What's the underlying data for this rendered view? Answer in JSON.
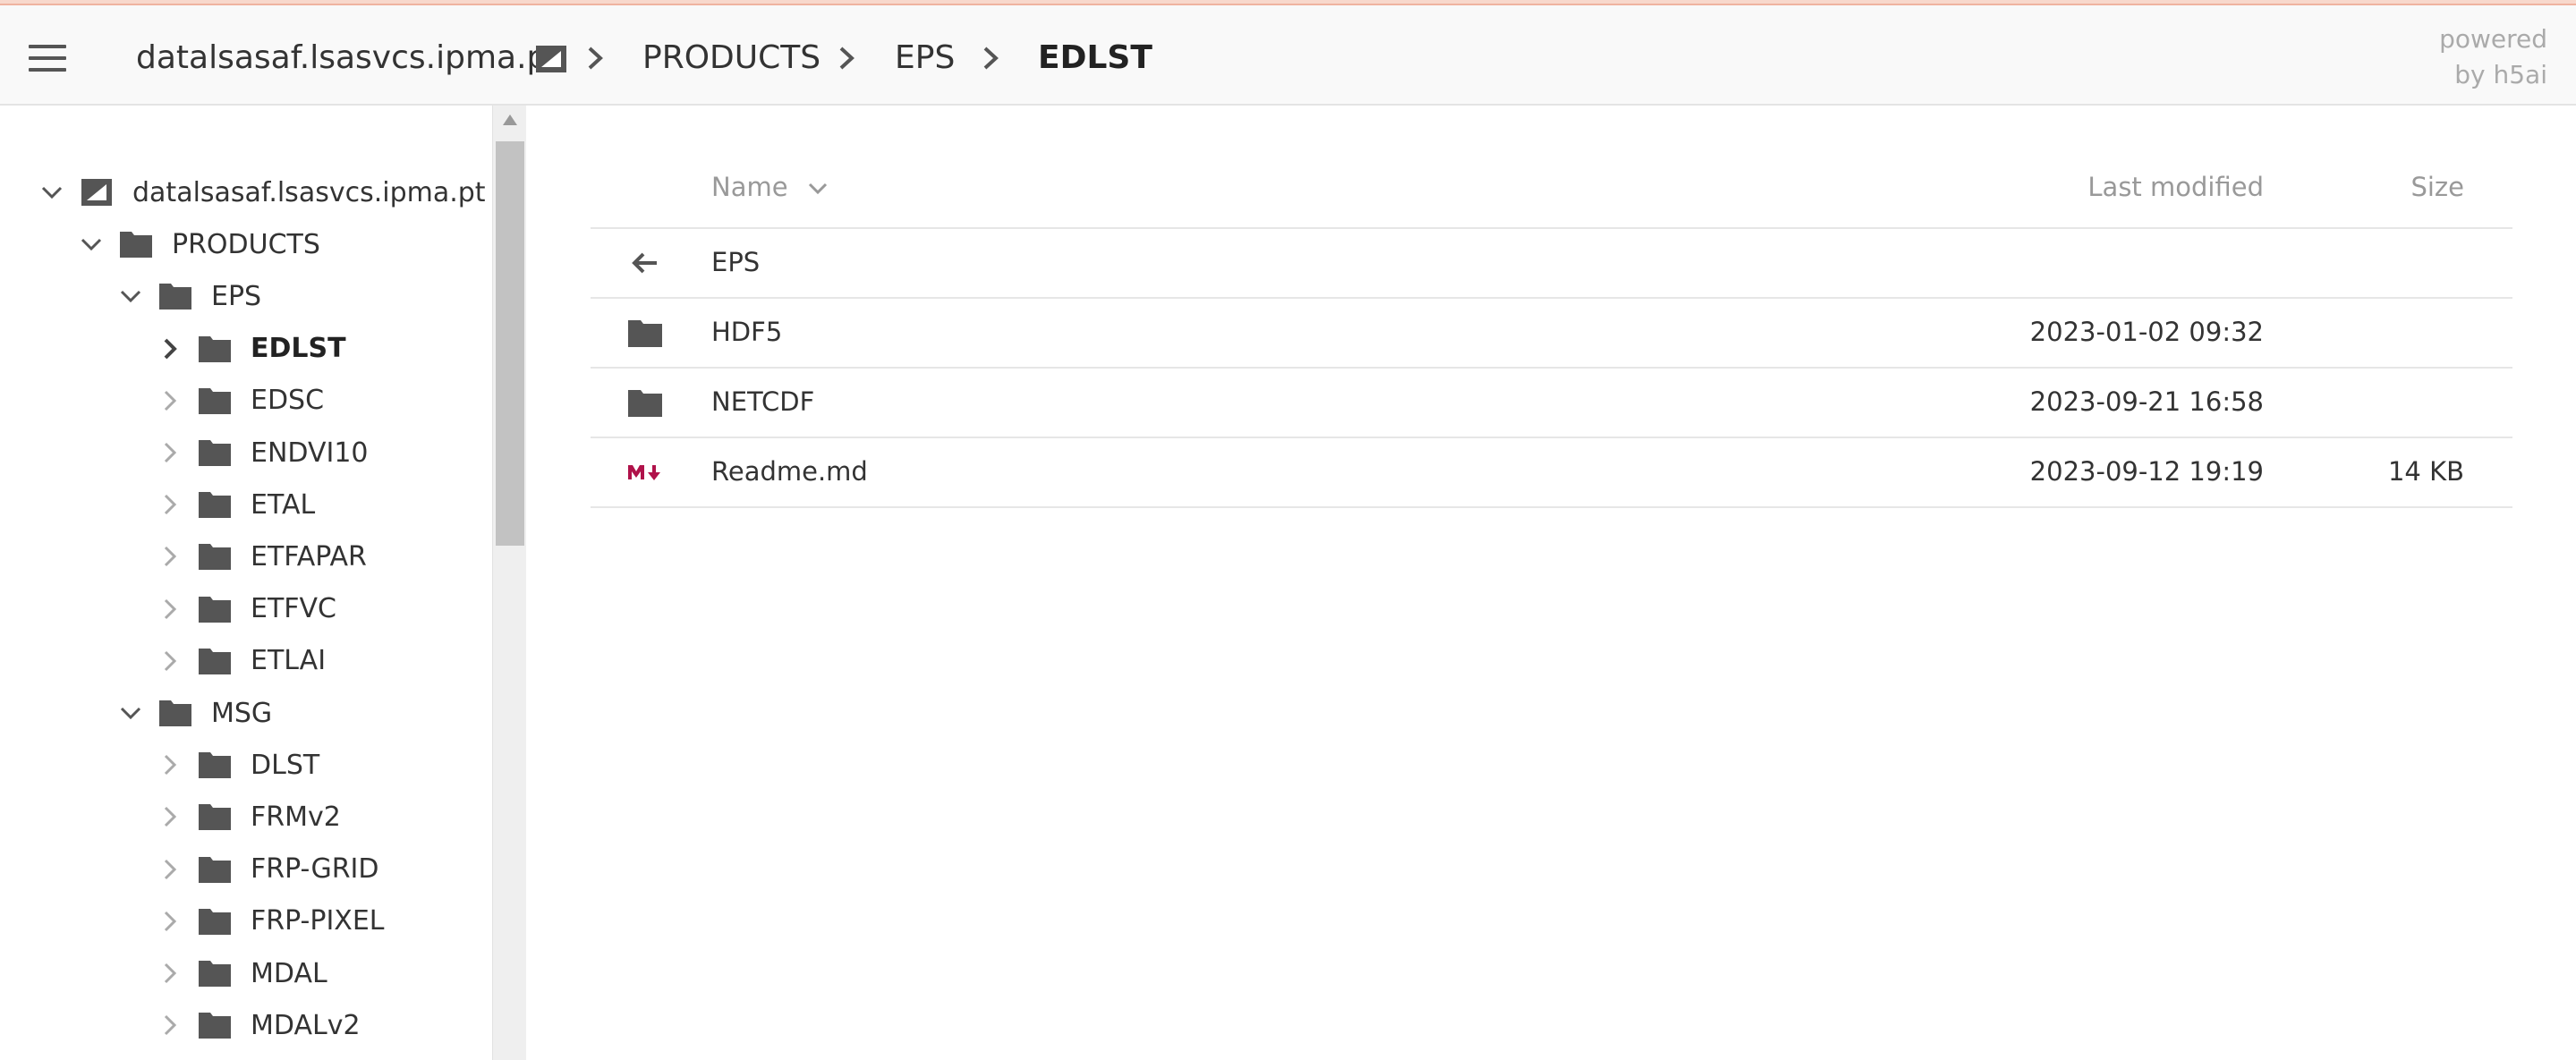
{
  "header": {
    "breadcrumb": [
      {
        "label": "datalsasaf.lsasvcs.ipma.pt"
      },
      {
        "label": "PRODUCTS"
      },
      {
        "label": "EPS"
      },
      {
        "label": "EDLST"
      }
    ],
    "powered_line1": "powered",
    "powered_line2": "by h5ai"
  },
  "sidebar": {
    "tree": [
      {
        "label": "datalsasaf.lsasvcs.ipma.pt",
        "level": 0,
        "expanded": true,
        "icon": "root-folder-icon"
      },
      {
        "label": "PRODUCTS",
        "level": 1,
        "expanded": true,
        "icon": "folder-icon"
      },
      {
        "label": "EPS",
        "level": 2,
        "expanded": true,
        "icon": "folder-icon"
      },
      {
        "label": "EDLST",
        "level": 3,
        "expanded": false,
        "active": true,
        "icon": "folder-icon"
      },
      {
        "label": "EDSC",
        "level": 3,
        "expanded": false,
        "icon": "folder-icon"
      },
      {
        "label": "ENDVI10",
        "level": 3,
        "expanded": false,
        "icon": "folder-icon"
      },
      {
        "label": "ETAL",
        "level": 3,
        "expanded": false,
        "icon": "folder-icon"
      },
      {
        "label": "ETFAPAR",
        "level": 3,
        "expanded": false,
        "icon": "folder-icon"
      },
      {
        "label": "ETFVC",
        "level": 3,
        "expanded": false,
        "icon": "folder-icon"
      },
      {
        "label": "ETLAI",
        "level": 3,
        "expanded": false,
        "icon": "folder-icon"
      },
      {
        "label": "MSG",
        "level": 2,
        "expanded": true,
        "icon": "folder-icon"
      },
      {
        "label": "DLST",
        "level": 3,
        "expanded": false,
        "icon": "folder-icon"
      },
      {
        "label": "FRMv2",
        "level": 3,
        "expanded": false,
        "icon": "folder-icon"
      },
      {
        "label": "FRP-GRID",
        "level": 3,
        "expanded": false,
        "icon": "folder-icon"
      },
      {
        "label": "FRP-PIXEL",
        "level": 3,
        "expanded": false,
        "icon": "folder-icon"
      },
      {
        "label": "MDAL",
        "level": 3,
        "expanded": false,
        "icon": "folder-icon"
      },
      {
        "label": "MDALv2",
        "level": 3,
        "expanded": false,
        "icon": "folder-icon"
      }
    ]
  },
  "listing": {
    "columns": {
      "name": "Name",
      "modified": "Last modified",
      "size": "Size"
    },
    "rows": [
      {
        "icon": "back-arrow-icon",
        "name": "EPS",
        "modified": "",
        "size": ""
      },
      {
        "icon": "folder-icon",
        "name": "HDF5",
        "modified": "2023-01-02 09:32",
        "size": ""
      },
      {
        "icon": "folder-icon",
        "name": "NETCDF",
        "modified": "2023-09-21 16:58",
        "size": ""
      },
      {
        "icon": "markdown-icon",
        "name": "Readme.md",
        "modified": "2023-09-12 19:19",
        "size": "14 KB"
      }
    ]
  },
  "colors": {
    "markdown_icon": "#b0124a",
    "icon_gray": "#555555"
  }
}
